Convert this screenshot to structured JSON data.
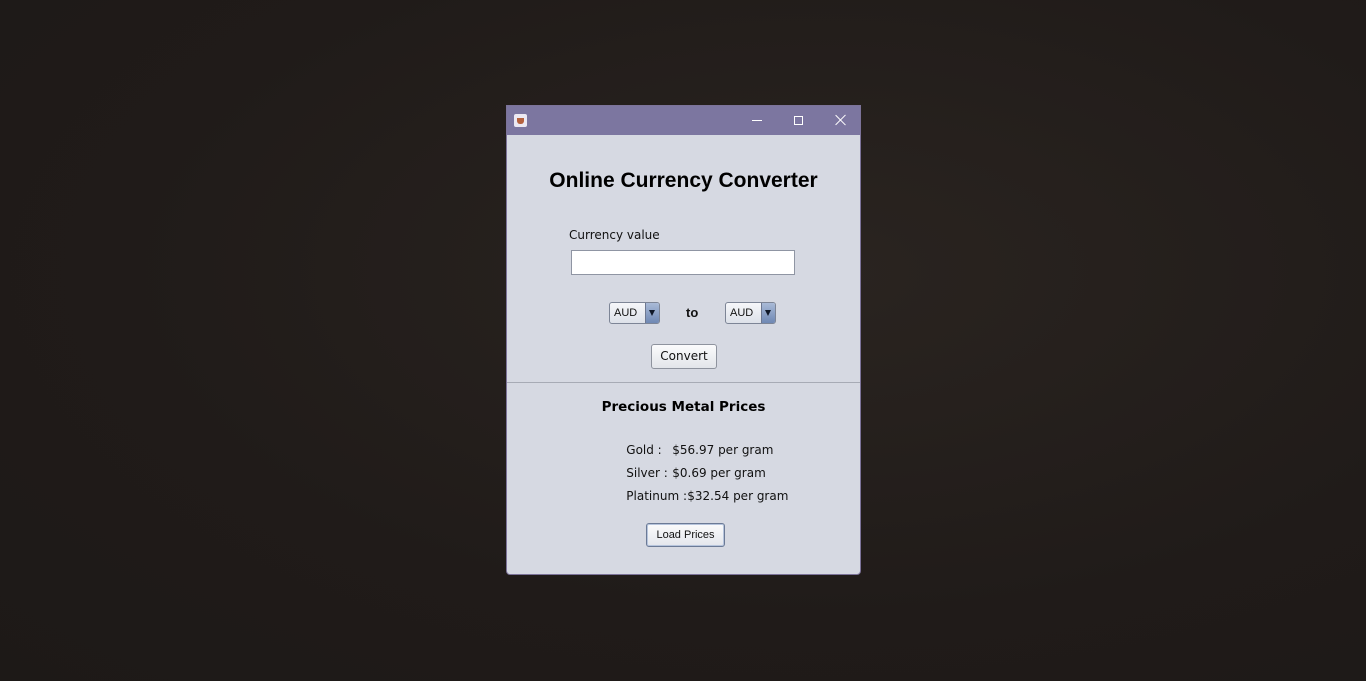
{
  "window": {
    "title_bar_color": "#7c76a0",
    "body_color": "#d6d9e2",
    "icon": "java-app-icon",
    "controls": {
      "minimize": "minimize-icon",
      "maximize": "maximize-icon",
      "close": "close-icon"
    }
  },
  "converter": {
    "title": "Online Currency Converter",
    "currency_label": "Currency value",
    "currency_input_value": "",
    "from_currency": "AUD",
    "to_label": "to",
    "to_currency": "AUD",
    "convert_button": "Convert"
  },
  "metals": {
    "heading": "Precious Metal Prices",
    "rows": [
      {
        "label": "Gold :",
        "price": "$56.97 per gram"
      },
      {
        "label": "Silver :",
        "price": "$0.69 per gram"
      },
      {
        "label": "Platinum :",
        "price": "$32.54 per gram"
      }
    ],
    "load_button": "Load Prices"
  }
}
